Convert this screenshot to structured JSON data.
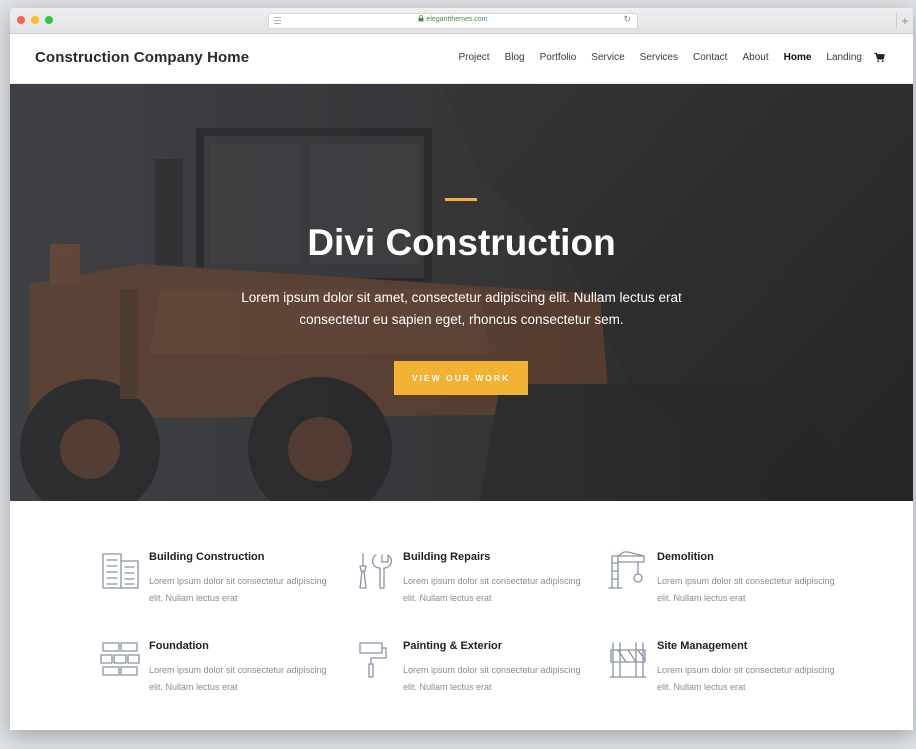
{
  "browser": {
    "url": "elegantthemes.com"
  },
  "header": {
    "logo": "Construction Company Home",
    "nav": [
      "Project",
      "Blog",
      "Portfolio",
      "Service",
      "Services",
      "Contact",
      "About",
      "Home",
      "Landing"
    ],
    "active_nav": "Home"
  },
  "hero": {
    "title": "Divi Construction",
    "subtitle": "Lorem ipsum dolor sit amet, consectetur adipiscing elit. Nullam lectus erat consectetur eu sapien eget, rhoncus consectetur sem.",
    "cta": "VIEW OUR WORK"
  },
  "features": [
    {
      "title": "Building Construction",
      "text": "Lorem ipsum dolor sit consectetur adipiscing elit. Nullam lectus erat",
      "icon": "building-icon"
    },
    {
      "title": "Building Repairs",
      "text": "Lorem ipsum dolor sit consectetur adipiscing elit. Nullam lectus erat",
      "icon": "tools-icon"
    },
    {
      "title": "Demolition",
      "text": "Lorem ipsum dolor sit consectetur adipiscing elit. Nullam lectus erat",
      "icon": "crane-icon"
    },
    {
      "title": "Foundation",
      "text": "Lorem ipsum dolor sit consectetur adipiscing elit. Nullam lectus erat",
      "icon": "bricks-icon"
    },
    {
      "title": "Painting & Exterior",
      "text": "Lorem ipsum dolor sit consectetur adipiscing elit. Nullam lectus erat",
      "icon": "paint-roller-icon"
    },
    {
      "title": "Site Management",
      "text": "Lorem ipsum dolor sit consectetur adipiscing elit. Nullam lectus erat",
      "icon": "barrier-icon"
    }
  ],
  "colors": {
    "accent": "#f2b233",
    "icon": "#8a93a3"
  }
}
